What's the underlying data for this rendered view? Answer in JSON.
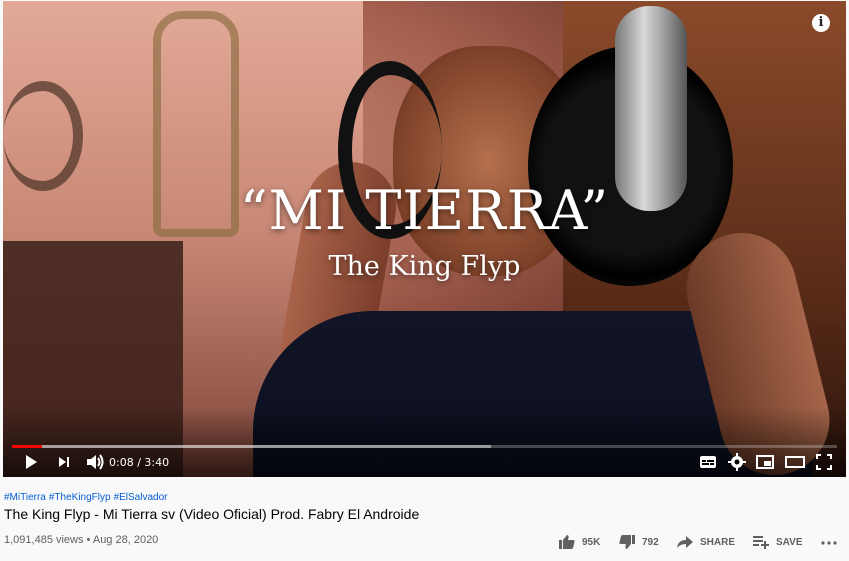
{
  "player": {
    "overlay_title": "“MI TIERRA”",
    "overlay_artist": "The King Flyp",
    "time_display": "0:08 / 3:40",
    "progress_played": 0.036,
    "progress_loaded": 0.58
  },
  "video": {
    "hashtags": [
      "#MiTierra",
      "#TheKingFlyp",
      "#ElSalvador"
    ],
    "title": "The King Flyp - Mi Tierra sv (Video Oficial) Prod. Fabry El Androide",
    "views_date": "1,091,485 views • Aug 28, 2020"
  },
  "actions": {
    "like": "95K",
    "dislike": "792",
    "share": "SHARE",
    "save": "SAVE"
  },
  "icons": [
    "info-icon",
    "play-icon",
    "next-icon",
    "volume-icon",
    "subtitles-icon",
    "settings-icon",
    "miniplayer-icon",
    "theater-icon",
    "fullscreen-icon",
    "thumbs-up-icon",
    "thumbs-down-icon",
    "share-icon",
    "save-playlist-icon",
    "more-icon"
  ],
  "colors": {
    "progress": "#ff0000",
    "link": "#065fd4",
    "text": "#030303",
    "muted": "#606060"
  }
}
